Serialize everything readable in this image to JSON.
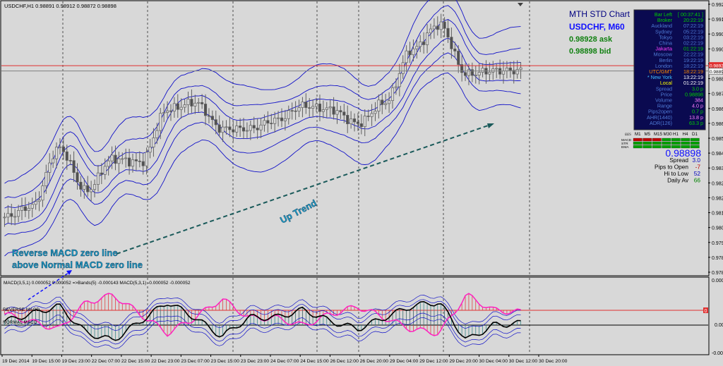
{
  "window": {
    "title": "USDCHF,H1  0.98891 0.98912 0.98872 0.98898"
  },
  "header": {
    "chart_title": "MTH STD Chart",
    "symbol_tf": "USDCHF, M60",
    "ask": "0.98928 ask",
    "bid": "0.98898 bid"
  },
  "annotations": {
    "reverse_line1": "Reverse MACD zero line",
    "reverse_line2": "above Normal MACD zero line",
    "uptrend": "Up Trend"
  },
  "info_panel": {
    "rows": [
      {
        "label": "Bar Left",
        "value": "[ 00:37:41 ]",
        "label_color": "#00d000",
        "value_color": "#00d000"
      },
      {
        "label": "Broker",
        "value": "20:22:19",
        "label_color": "#00d000",
        "value_color": "#00d000"
      },
      {
        "label": "Auckland",
        "value": "07:22:19",
        "label_color": "#4f7bd6",
        "value_color": "#4f7bd6"
      },
      {
        "label": "Sydney",
        "value": "05:22:19",
        "label_color": "#4f7bd6",
        "value_color": "#4f7bd6"
      },
      {
        "label": "Tokyo",
        "value": "03:22:19",
        "label_color": "#4f7bd6",
        "value_color": "#4f7bd6"
      },
      {
        "label": "China",
        "value": "02:22:19",
        "label_color": "#4f7bd6",
        "value_color": "#4f7bd6"
      },
      {
        "label": "Jakarta",
        "value": "01:22:19",
        "label_color": "#ff40ff",
        "value_color": "#00d000"
      },
      {
        "label": "Moscow",
        "value": "22:22:19",
        "label_color": "#4f7bd6",
        "value_color": "#4f7bd6"
      },
      {
        "label": "Berlin",
        "value": "19:22:19",
        "label_color": "#4f7bd6",
        "value_color": "#4f7bd6"
      },
      {
        "label": "London",
        "value": "18:22:19",
        "label_color": "#4f7bd6",
        "value_color": "#4f7bd6"
      },
      {
        "label": "UTC/GMT",
        "value": "18:22:19",
        "label_color": "#ff8c00",
        "value_color": "#ff8c00"
      },
      {
        "label": "* New York",
        "value": "13:22:19",
        "label_color": "#40c0ff",
        "value_color": "#ffffff"
      },
      {
        "label": "Local",
        "value": "01:22:19",
        "label_color": "#ffff00",
        "value_color": "#ffffff"
      },
      {
        "label": "Spread",
        "value": "3.0 p",
        "label_color": "#4f7bd6",
        "value_color": "#00d000"
      },
      {
        "label": "Price",
        "value": "0.98898",
        "label_color": "#4f7bd6",
        "value_color": "#00d000"
      },
      {
        "label": "Volume",
        "value": "384",
        "label_color": "#4f7bd6",
        "value_color": "#ff80ff"
      },
      {
        "label": "Range",
        "value": "4.0 p",
        "label_color": "#4f7bd6",
        "value_color": "#ff80ff"
      },
      {
        "label": "Pips2open",
        "value": "0.7 p",
        "label_color": "#4f7bd6",
        "value_color": "#00d000"
      },
      {
        "label": "AHR(1440)",
        "value": "13.8 p",
        "label_color": "#4f7bd6",
        "value_color": "#ff80ff"
      },
      {
        "label": "ADR(126)",
        "value": "63.3 p",
        "label_color": "#4f7bd6",
        "value_color": "#00d000"
      }
    ]
  },
  "signal_grid": {
    "header_left": "ɕɕs",
    "timeframes": [
      "M1",
      "M5",
      "M15",
      "M30",
      "H1",
      "H4",
      "D1"
    ],
    "rows": [
      {
        "label": "MACD",
        "colors": [
          "#c00000",
          "#c00000",
          "#c00000",
          "#00a000",
          "#00a000",
          "#00a000",
          "#00a000"
        ]
      },
      {
        "label": "STR",
        "colors": [
          "#00a000",
          "#00a000",
          "#00a000",
          "#00a000",
          "#00a000",
          "#00a000",
          "#00a000"
        ]
      },
      {
        "label": "EMA",
        "colors": [
          "#00a000",
          "#00a000",
          "#00a000",
          "#00a000",
          "#00a000",
          "#00a000",
          "#00a000"
        ]
      }
    ]
  },
  "stats": {
    "price": "0.98898",
    "items": [
      {
        "label": "Spread",
        "value": "3.0",
        "value_color": "#0000c0"
      },
      {
        "label": "Pips to Open",
        "value": "-7",
        "value_color": "#c00000"
      },
      {
        "label": "Hi to Low",
        "value": "52",
        "value_color": "#0000c0"
      },
      {
        "label": "Daily Av",
        "value": "66",
        "value_color": "#008000"
      }
    ]
  },
  "price_axis": {
    "ticks": [
      "0.99245",
      "0.99165",
      "0.99085",
      "0.99005",
      "0.98925",
      "0.98845",
      "0.98765",
      "0.98685",
      "0.98605",
      "0.98525",
      "0.98445",
      "0.98365",
      "0.98285",
      "0.98205",
      "0.98125",
      "0.98045",
      "0.97965",
      "0.97885",
      "0.97805"
    ],
    "ask_label": "0.98928",
    "bid_label": "0.98898"
  },
  "indicator": {
    "header": "MACD(3,5,1) 0.000052 0.000052  =>Bands(5) -0.000143  MACD(5,3,1) -0.000052 -0.000052",
    "reverse_label": "REVERSE MACD",
    "normal_label": "NORMAL MACD",
    "axis_top": "0.000769",
    "axis_zero": "0.00",
    "axis_bottom": "-0.000722",
    "box_label": "0"
  },
  "time_axis": {
    "labels": [
      "19 Dec 2014",
      "19 Dec 15:00",
      "19 Dec 23:00",
      "22 Dec 07:00",
      "22 Dec 15:00",
      "22 Dec 23:00",
      "23 Dec 07:00",
      "23 Dec 15:00",
      "23 Dec 23:00",
      "24 Dec 07:00",
      "24 Dec 15:00",
      "26 Dec 12:00",
      "26 Dec 20:00",
      "29 Dec 04:00",
      "29 Dec 12:00",
      "29 Dec 20:00",
      "30 Dec 04:00",
      "30 Dec 12:00",
      "30 Dec 20:00"
    ]
  },
  "colors": {
    "background": "#d8d8d8",
    "bands": "#1010c8",
    "candles": "#606060",
    "ask_line": "#e03030",
    "bid_line": "#808080",
    "macd_normal": "#000000",
    "macd_reverse": "#ff20c0",
    "trend_arrow": "#1a5a5a",
    "annotation_text": "#1c9ec8"
  },
  "chart_data": {
    "type": "line",
    "title": "MTH STD Chart",
    "symbol": "USDCHF",
    "timeframe": "H1",
    "ohlc_current": {
      "open": 0.98891,
      "high": 0.98912,
      "low": 0.98872,
      "close": 0.98898
    },
    "ask": 0.98928,
    "bid": 0.98898,
    "ylim": [
      0.9775,
      0.9928
    ],
    "x": [
      0,
      8,
      16,
      24,
      32,
      40,
      48,
      56,
      64,
      72,
      80,
      88,
      96,
      104,
      112,
      120,
      128,
      136,
      144,
      152
    ],
    "x_tick_labels": [
      "19 Dec 2014",
      "19 Dec 15:00",
      "19 Dec 23:00",
      "22 Dec 07:00",
      "22 Dec 15:00",
      "22 Dec 23:00",
      "23 Dec 07:00",
      "23 Dec 15:00",
      "23 Dec 23:00",
      "24 Dec 07:00",
      "24 Dec 15:00",
      "26 Dec 12:00",
      "26 Dec 20:00",
      "29 Dec 04:00",
      "29 Dec 12:00",
      "29 Dec 20:00",
      "30 Dec 04:00",
      "30 Dec 12:00",
      "30 Dec 20:00"
    ],
    "series": [
      {
        "name": "Price",
        "values": [
          0.9807,
          0.9813,
          0.9846,
          0.9822,
          0.984,
          0.9838,
          0.9868,
          0.9872,
          0.9857,
          0.9857,
          0.9862,
          0.987,
          0.9868,
          0.986,
          0.9872,
          0.9902,
          0.9916,
          0.9888,
          0.989,
          0.989
        ]
      }
    ],
    "indicator_series": [
      {
        "name": "MACD(3,5,1)",
        "values": [
          0.0001,
          0.0003,
          0.0005,
          -0.0002,
          -0.0004,
          0.0001,
          0.0006,
          0.0002,
          -0.0003,
          0.0002,
          0.0002,
          0.0004,
          0.0001,
          -0.0001,
          0.0002,
          0.0005,
          0.0006,
          -0.0004,
          0.0,
          5e-05
        ]
      },
      {
        "name": "MACD(5,3,1)",
        "values": [
          -0.0001,
          -0.0003,
          -0.0005,
          0.0002,
          0.0004,
          -0.0001,
          -0.0006,
          -0.0002,
          0.0003,
          -0.0002,
          -0.0002,
          -0.0004,
          -0.0001,
          0.0001,
          -0.0002,
          -0.0005,
          -0.0006,
          0.0004,
          0.0,
          -5e-05
        ]
      }
    ],
    "indicator_ylim": [
      -0.000722,
      0.000769
    ],
    "grid": true,
    "legend": "none"
  }
}
